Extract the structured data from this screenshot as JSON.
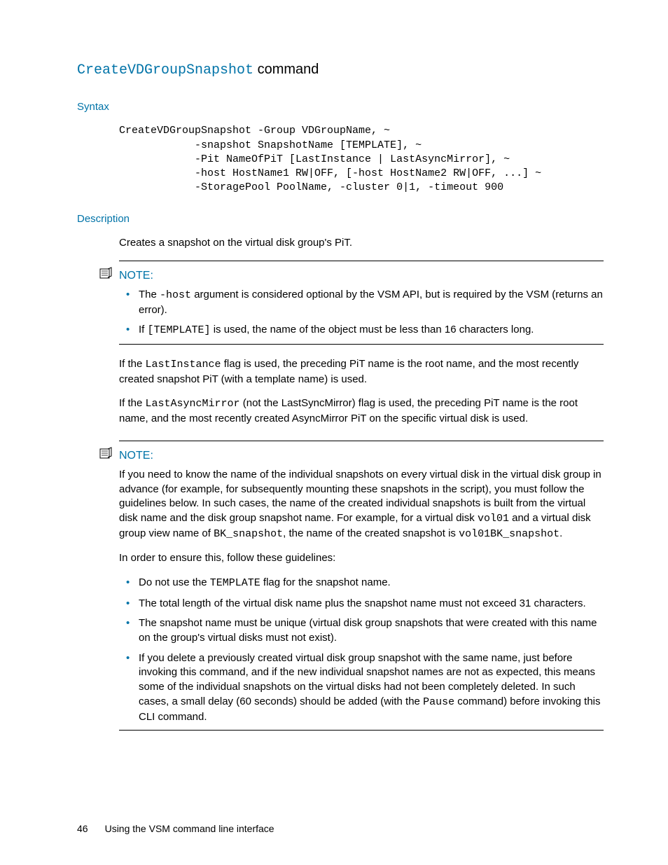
{
  "title": {
    "cmd": "CreateVDGroupSnapshot",
    "tail": " command"
  },
  "syntax": {
    "heading": "Syntax",
    "lines": [
      "CreateVDGroupSnapshot -Group VDGroupName, ~",
      "            -snapshot SnapshotName [TEMPLATE], ~",
      "            -Pit NameOfPiT [LastInstance | LastAsyncMirror], ~",
      "            -host HostName1 RW|OFF, [-host HostName2 RW|OFF, ...] ~",
      "            -StoragePool PoolName, -cluster 0|1, -timeout 900"
    ]
  },
  "desc": {
    "heading": "Description",
    "body": "Creates a snapshot on the virtual disk group's PiT."
  },
  "note1": {
    "label": "NOTE:",
    "b1a": "The ",
    "b1code": "-host",
    "b1b": " argument is considered optional by the VSM API, but is required by the VSM (returns an error).",
    "b2a": "If ",
    "b2code": "[TEMPLATE]",
    "b2b": " is used, the name of the object must be less than 16 characters long."
  },
  "post": {
    "p1a": "If the ",
    "p1code": "LastInstance",
    "p1b": " flag is used, the preceding PiT name is the root name, and the most recently created snapshot PiT (with a template name) is used.",
    "p2a": "If the ",
    "p2code": "LastAsyncMirror",
    "p2b": " (not the LastSyncMirror) flag is used, the preceding PiT name is the root name, and the most recently created AsyncMirror PiT on the specific virtual disk is used."
  },
  "note2": {
    "label": "NOTE:",
    "intro_a": "If you need to know the name of the individual snapshots on every virtual disk in the virtual disk group in advance (for example, for subsequently mounting these snapshots in the script), you must follow the guidelines below. In such cases, the name of the created individual snapshots is built from the virtual disk name and the disk group snapshot name. For example, for a virtual disk ",
    "intro_c1": "vol01",
    "intro_b": " and a virtual disk group view name of ",
    "intro_c2": "BK_snapshot",
    "intro_c": ", the name of the created snapshot is ",
    "intro_c3": "vol01BK_snapshot",
    "intro_d": ".",
    "lead": "In order to ensure this, follow these guidelines:",
    "g1a": "Do not use the ",
    "g1code": "TEMPLATE",
    "g1b": " flag for the snapshot name.",
    "g2": "The total length of the virtual disk name plus the snapshot name must not exceed 31 characters.",
    "g3": "The snapshot name must be unique (virtual disk group snapshots that were created with this name on the group's virtual disks must not exist).",
    "g4a": "If you delete a previously created virtual disk group snapshot with the same name, just before invoking this command, and if the new individual snapshot names are not as expected, this means some of the individual snapshots on the virtual disks had not been completely deleted. In such cases, a small delay (60 seconds) should be added (with the ",
    "g4code": "Pause",
    "g4b": " command) before invoking this CLI command."
  },
  "footer": {
    "page": "46",
    "title": "Using the VSM command line interface"
  }
}
